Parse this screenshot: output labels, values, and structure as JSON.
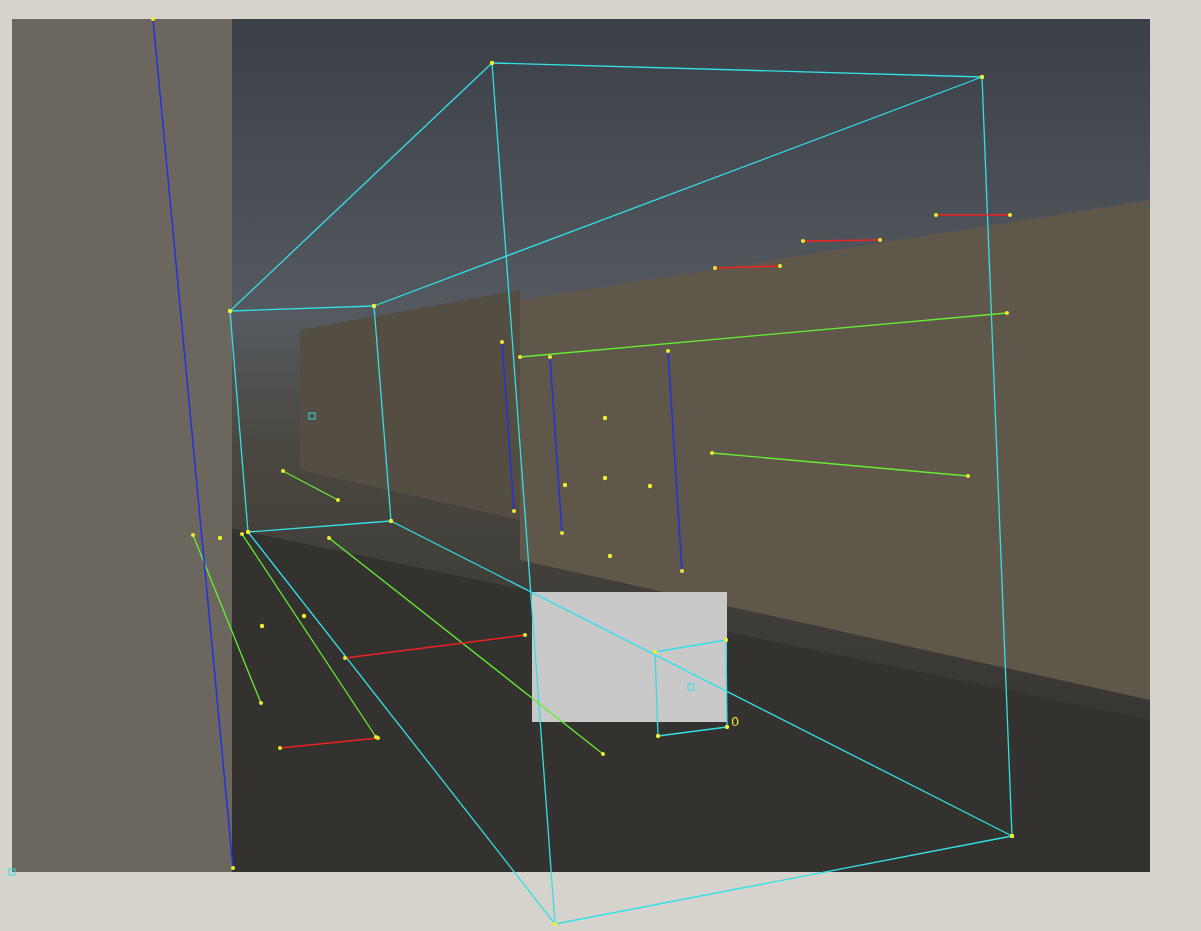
{
  "canvas": {
    "marker_label": "0"
  }
}
